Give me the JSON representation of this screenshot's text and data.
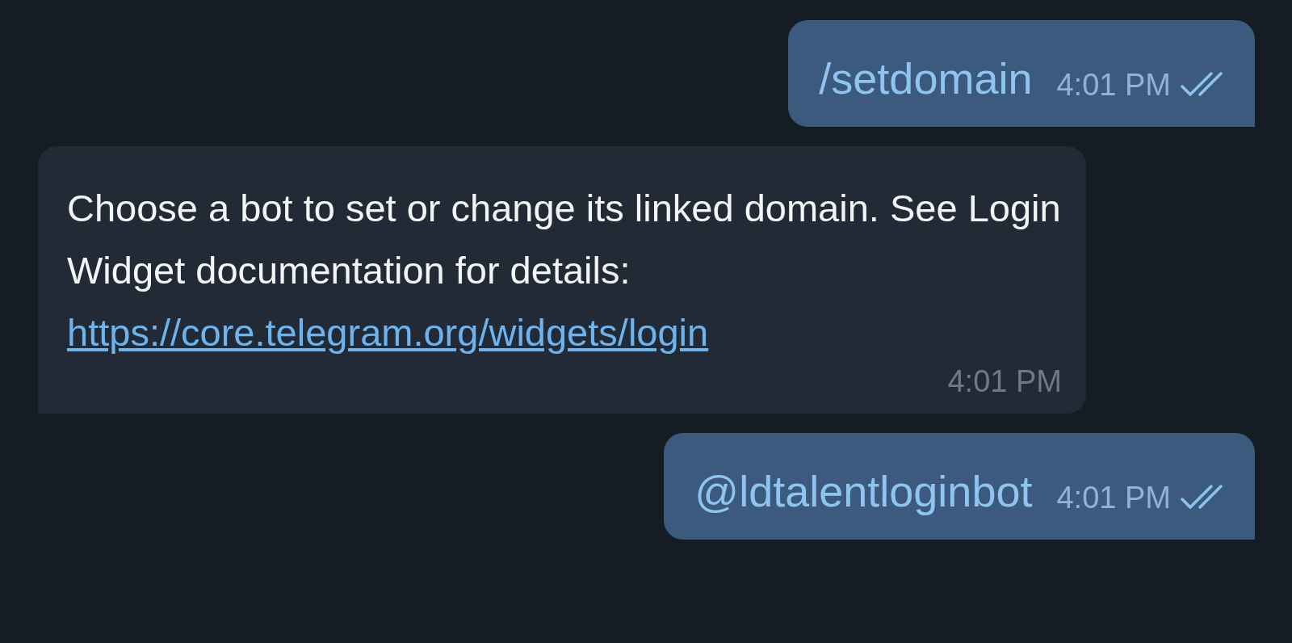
{
  "messages": [
    {
      "kind": "outgoing",
      "text": "/setdomain",
      "time": "4:01 PM",
      "read": true
    },
    {
      "kind": "incoming",
      "text": "Choose a bot to set or change its linked domain. See Login Widget documentation for details:",
      "link": "https://core.telegram.org/widgets/login",
      "time": "4:01 PM"
    },
    {
      "kind": "outgoing",
      "text": "@ldtalentloginbot",
      "time": "4:01 PM",
      "read": true
    }
  ]
}
